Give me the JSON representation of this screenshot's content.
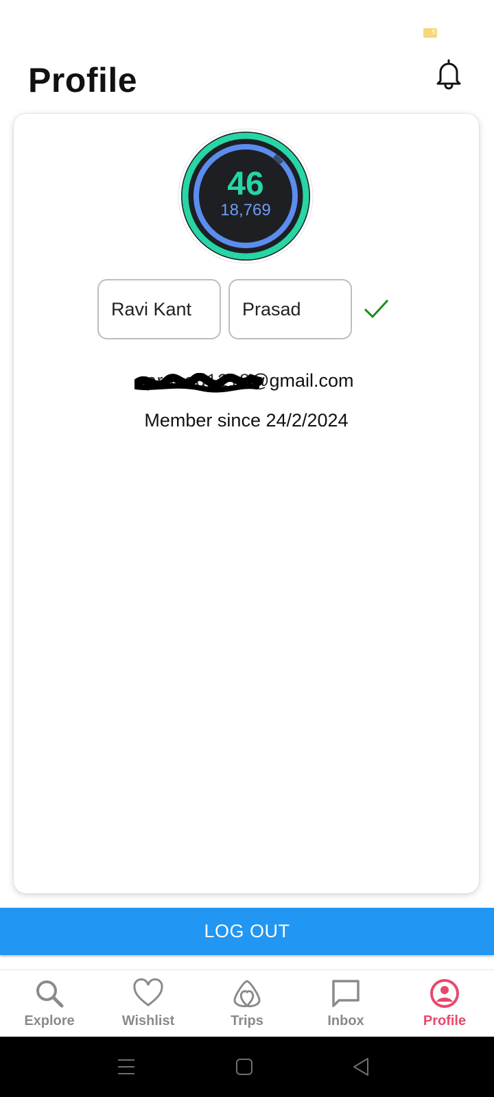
{
  "status_bar": {
    "badge": "5",
    "badge_color": "#f6d77a"
  },
  "header": {
    "title": "Profile",
    "bell_icon": "bell-icon"
  },
  "level": {
    "number": "46",
    "points": "18,769",
    "ring_color": "#27d5a5",
    "inner_ring_color": "#5b8def"
  },
  "form": {
    "first_name": "Ravi Kant",
    "last_name": "Prasad"
  },
  "email": {
    "visible_suffix": "@gmail.com",
    "redacted": true
  },
  "member_since": "Member since 24/2/2024",
  "logout_label": "LOG OUT",
  "colors": {
    "accent": "#2196f3",
    "active_nav": "#e8496b",
    "inactive_nav": "#8a8a8a",
    "check": "#1a8a1a"
  },
  "bottom_nav": {
    "items": [
      {
        "label": "Explore",
        "icon": "search-icon",
        "active": false
      },
      {
        "label": "Wishlist",
        "icon": "heart-icon",
        "active": false
      },
      {
        "label": "Trips",
        "icon": "airbnb-logo-icon",
        "active": false
      },
      {
        "label": "Inbox",
        "icon": "message-icon",
        "active": false
      },
      {
        "label": "Profile",
        "icon": "user-circle-icon",
        "active": true
      }
    ]
  },
  "system_nav": {
    "buttons": [
      "menu-icon",
      "home-icon",
      "back-icon"
    ]
  }
}
